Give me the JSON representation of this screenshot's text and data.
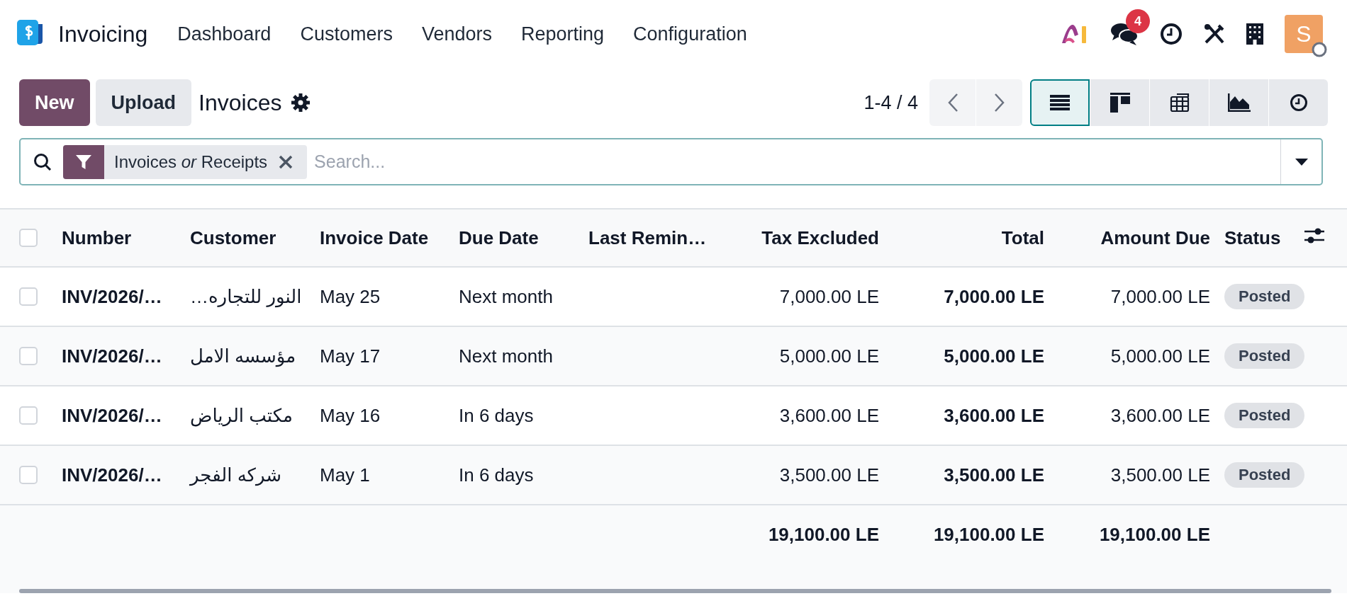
{
  "navbar": {
    "app_name": "Invoicing",
    "menu": [
      "Dashboard",
      "Customers",
      "Vendors",
      "Reporting",
      "Configuration"
    ],
    "messages_badge": "4",
    "avatar_initial": "S"
  },
  "control_panel": {
    "buttons": [
      "New",
      "Upload"
    ],
    "title": "Invoices",
    "pager": "1-4 / 4",
    "views": [
      {
        "kind": "list",
        "selected": true
      },
      {
        "kind": "kanban",
        "selected": false
      },
      {
        "kind": "pivot",
        "selected": false
      },
      {
        "kind": "graph",
        "selected": false
      },
      {
        "kind": "activity",
        "selected": false
      }
    ]
  },
  "search": {
    "facet": "Invoices *or* Receipts",
    "placeholder": "Search..."
  },
  "table": {
    "columns": [
      "Number",
      "Customer",
      "Invoice Date",
      "Due Date",
      "Last Remin…",
      "Tax Excluded",
      "Total",
      "Amount Due",
      "Status"
    ],
    "select_all_checked": false,
    "rows": [
      {
        "checked": false,
        "number": "INV/2026/…",
        "customer": "النور للتجاره…",
        "invoice_date": "May 25",
        "due_date": "Next month",
        "tax_excluded": "7,000.00 LE",
        "total": "7,000.00 LE",
        "amount_due": "7,000.00 LE",
        "status": "Posted"
      },
      {
        "checked": false,
        "number": "INV/2026/…",
        "customer": "مؤسسه الامل",
        "invoice_date": "May 17",
        "due_date": "Next month",
        "tax_excluded": "5,000.00 LE",
        "total": "5,000.00 LE",
        "amount_due": "5,000.00 LE",
        "status": "Posted"
      },
      {
        "checked": false,
        "number": "INV/2026/…",
        "customer": "مكتب الرياض",
        "invoice_date": "May 16",
        "due_date": "In 6 days",
        "tax_excluded": "3,600.00 LE",
        "total": "3,600.00 LE",
        "amount_due": "3,600.00 LE",
        "status": "Posted"
      },
      {
        "checked": false,
        "number": "INV/2026/…",
        "customer": "شركه الفجر",
        "invoice_date": "May 1",
        "due_date": "In 6 days",
        "tax_excluded": "3,500.00 LE",
        "total": "3,500.00 LE",
        "amount_due": "3,500.00 LE",
        "status": "Posted"
      }
    ],
    "totals": {
      "tax_excluded": "19,100.00 LE",
      "total": "19,100.00 LE",
      "amount_due": "19,100.00 LE"
    }
  }
}
